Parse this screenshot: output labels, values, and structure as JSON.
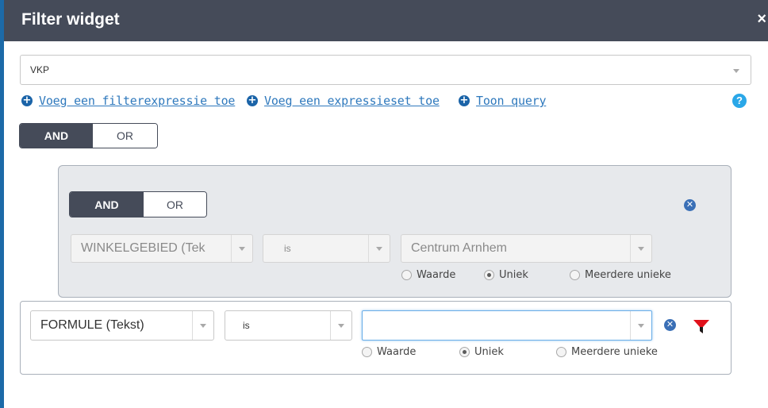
{
  "dialog": {
    "title": "Filter widget",
    "close_label": "×"
  },
  "layer_select": {
    "value": "VKP"
  },
  "links": [
    {
      "label": "Voeg een filterexpressie toe"
    },
    {
      "label": "Voeg een expressieset toe"
    },
    {
      "label": "Toon query"
    }
  ],
  "help_label": "?",
  "top_toggle": {
    "and": "AND",
    "or": "OR",
    "selected": "AND"
  },
  "group": {
    "toggle": {
      "and": "AND",
      "or": "OR",
      "selected": "AND"
    },
    "field": "WINKELGEBIED (Tek",
    "operator": "is",
    "value": "Centrum Arnhem",
    "radios": [
      "Waarde",
      "Uniek",
      "Meerdere unieke"
    ],
    "selected_radio": "Uniek"
  },
  "expression": {
    "field": "FORMULE (Tekst)",
    "operator": "is",
    "value": "",
    "radios": [
      "Waarde",
      "Uniek",
      "Meerdere unieke"
    ],
    "selected_radio": "Uniek"
  },
  "colors": {
    "titlebar": "#454b59",
    "link": "#2f79bd",
    "accent": "#1b64a8",
    "help": "#2aa7e8",
    "filter_icon": "#e0111b"
  }
}
